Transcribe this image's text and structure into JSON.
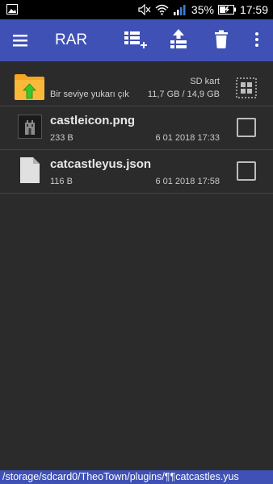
{
  "status_bar": {
    "notification_icon": "image-icon",
    "battery_percent": "35%",
    "time": "17:59"
  },
  "app_bar": {
    "title": "RAR",
    "actions": [
      "add-to-archive-icon",
      "extract-icon",
      "delete-icon",
      "more-vert-icon"
    ]
  },
  "parent_row": {
    "label": "Bir seviye yukarı çık",
    "storage": "SD kart",
    "space": "11,7 GB / 14,9 GB"
  },
  "files": [
    {
      "name": "castleicon.png",
      "size": "233 B",
      "date": "6 01 2018 17:33",
      "icon": "image-file-icon"
    },
    {
      "name": "catcastleyus.json",
      "size": "116 B",
      "date": "6 01 2018 17:58",
      "icon": "document-file-icon"
    }
  ],
  "path": "/storage/sdcard0/TheoTown/plugins/¶¶catcastles.yus",
  "colors": {
    "primary": "#3f51b5",
    "background": "#2b2b2b",
    "folder": "#f5a623",
    "arrow": "#35c92f"
  }
}
